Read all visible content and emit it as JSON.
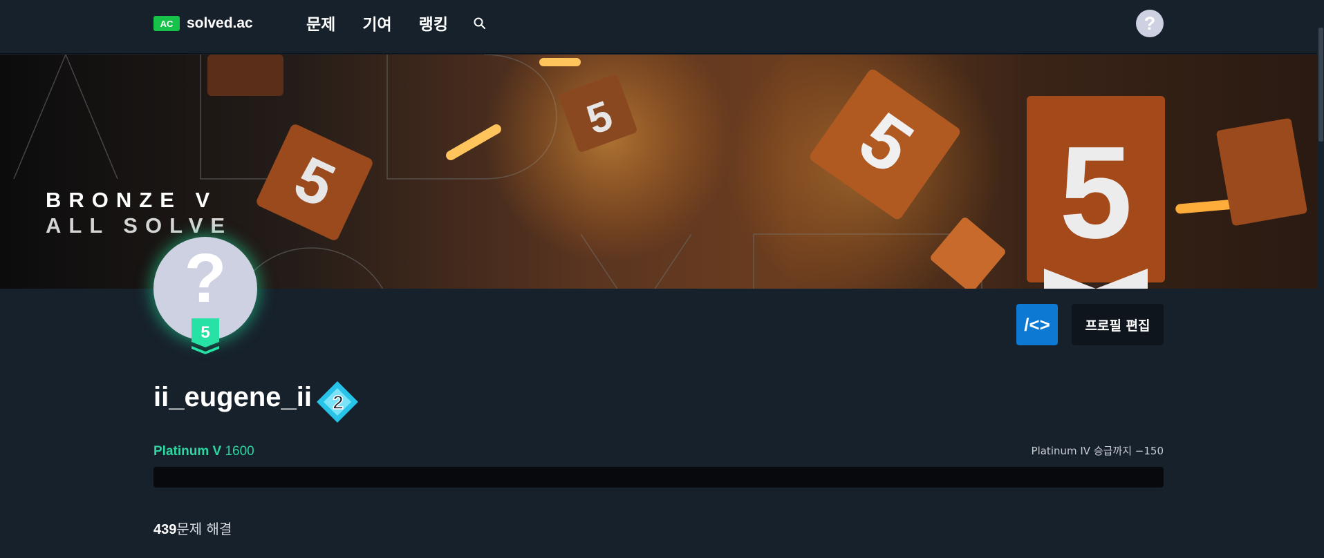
{
  "header": {
    "logo_badge": "AC",
    "logo_text": "solved.ac",
    "nav": [
      "문제",
      "기여",
      "랭킹"
    ],
    "search_icon": "search-icon",
    "help_label": "?"
  },
  "banner": {
    "title": "BRONZE V",
    "subtitle": "ALL SOLVE"
  },
  "profile": {
    "avatar_placeholder": "?",
    "tier_badge_level": "5",
    "username": "ii_eugene_ii",
    "rank_badge_level": "2",
    "code_button_label": "/<>",
    "edit_button_label": "프로필 편집"
  },
  "rating": {
    "tier_name": "Platinum V",
    "value": "1600",
    "next_tier_text": "Platinum IV 승급까지 −150",
    "progress": 0
  },
  "stats": {
    "solved_count": "439",
    "solved_label": "문제 해결"
  },
  "colors": {
    "background": "#17212c",
    "accent_green": "#2ed6a0",
    "logo_green": "#17c24a",
    "code_button_blue": "#0d79d2",
    "rank_diamond": "#27c3e8"
  }
}
